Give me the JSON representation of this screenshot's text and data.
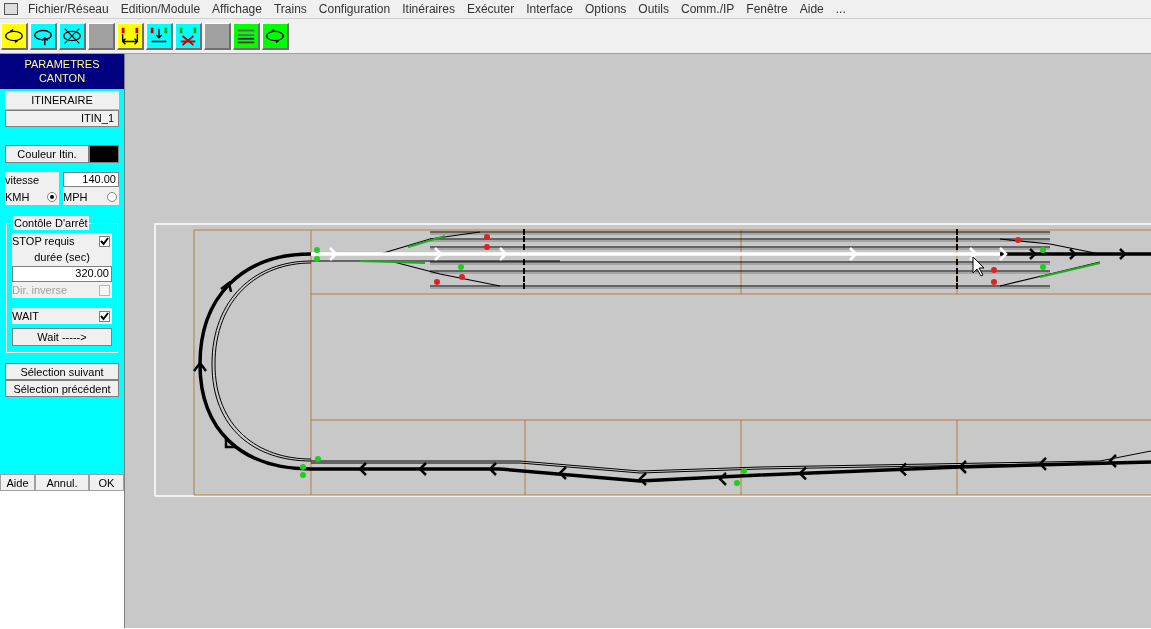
{
  "menu_bar": {
    "items": [
      "Fichier/Réseau",
      "Edition/Module",
      "Affichage",
      "Trains",
      "Configuration",
      "Itinéraires",
      "Exécuter",
      "Interface",
      "Options",
      "Outils",
      "Comm./IP",
      "Fenêtre",
      "Aide",
      "..."
    ]
  },
  "toolbar": {
    "buttons": [
      {
        "kind": "loop",
        "color": "#ffff00"
      },
      {
        "kind": "loop-arrow",
        "color": "#00ffff"
      },
      {
        "kind": "loop-cross",
        "color": "#00ffff"
      },
      {
        "kind": "blank",
        "color": "#a0a0a0"
      },
      {
        "kind": "signal-span",
        "color": "#ffff00"
      },
      {
        "kind": "signal-down",
        "color": "#00ffff"
      },
      {
        "kind": "signal-cross",
        "color": "#00ffff"
      },
      {
        "kind": "blank",
        "color": "#a0a0a0"
      },
      {
        "kind": "lines",
        "color": "#00ff00"
      },
      {
        "kind": "loop",
        "color": "#00ff00"
      }
    ]
  },
  "panel": {
    "title_lines": [
      "PARAMETRES",
      "CANTON"
    ],
    "itinerary_label": "ITINERAIRE",
    "itinerary_value": "ITIN_1",
    "color_button": "Couleur Itin.",
    "swatch": {
      "color": "#000000"
    },
    "speed_label": "vitesse",
    "speed_value": "140.00",
    "units": [
      {
        "label": "KMH",
        "selected": true
      },
      {
        "label": "MPH",
        "selected": false
      }
    ],
    "stop_group": {
      "legend": "Contôle D'arrêt",
      "stop": {
        "label": "STOP requis",
        "checked": true
      },
      "duration_label": "durée (sec)",
      "duration_value": "320.00",
      "reverse": {
        "label": "Dir. inverse",
        "checked": false,
        "disabled": true
      },
      "wait": {
        "label": "WAIT",
        "checked": true
      },
      "wait_button": "Wait ----->"
    },
    "nav_buttons": [
      "Sélection suivant",
      "Sélection précédent"
    ],
    "footer_buttons": [
      "Aide",
      "Annul.",
      "OK"
    ]
  }
}
